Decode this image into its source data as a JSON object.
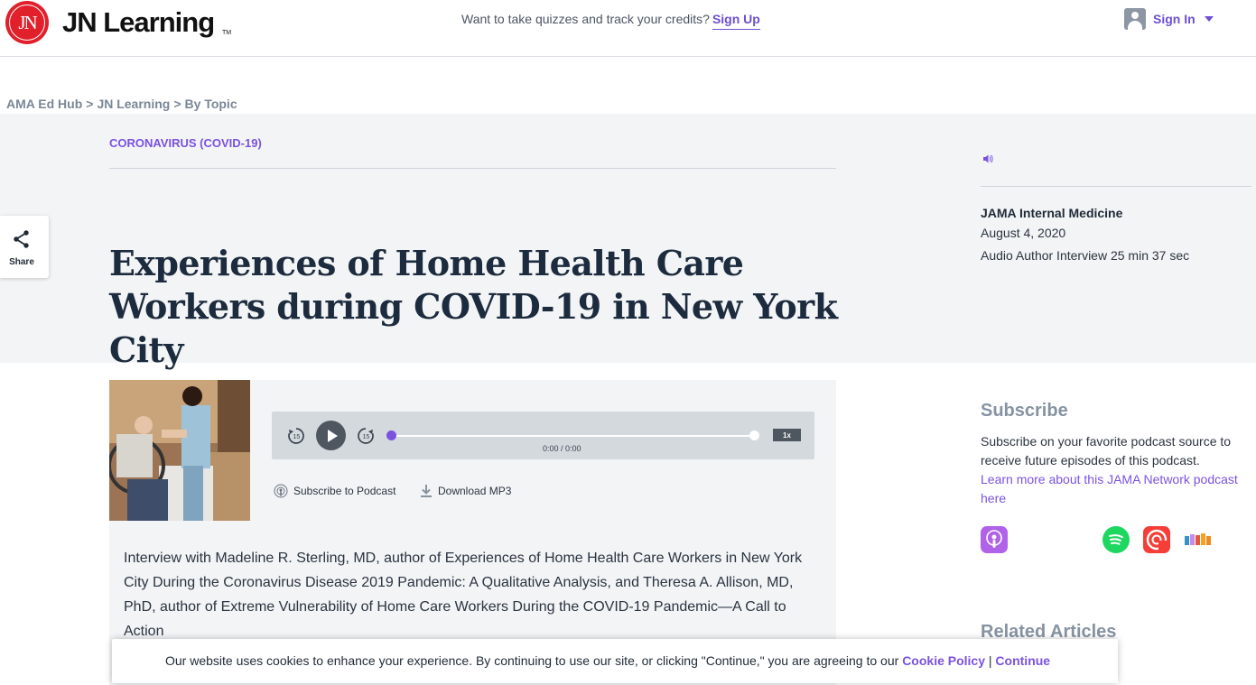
{
  "header": {
    "logo_badge": "JN",
    "logo_text": "JN Learning",
    "logo_tm": "TM",
    "cta_text": "Want to take quizzes and track your credits?",
    "cta_link": "Sign Up",
    "signin_label": "Sign In",
    "signin_icon": "user-icon"
  },
  "breadcrumb": {
    "items": [
      "AMA Ed Hub",
      "JN Learning",
      "By Topic"
    ],
    "separator": ">"
  },
  "share": {
    "label": "Share",
    "icon": "share-icon"
  },
  "article": {
    "topic": "CORONAVIRUS (COVID-19)",
    "title": "Experiences of Home Health Care Workers during COVID-19 in New York City",
    "journal": "JAMA Internal Medicine",
    "date": "August 4, 2020",
    "meta": "Audio Author Interview 25 min 37 sec",
    "audio_icon": "speaker-icon"
  },
  "player": {
    "time": "0:00 / 0:00",
    "speed": "1x",
    "progress": 0,
    "rewind_icon": "rewind-15-icon",
    "forward_icon": "forward-15-icon",
    "play_icon": "play-icon"
  },
  "links": {
    "subscribe": "Subscribe to Podcast",
    "download": "Download MP3"
  },
  "description": "Interview with Madeline R. Sterling, MD, author of Experiences of Home Health Care Workers in New York City During the Coronavirus Disease 2019 Pandemic: A Qualitative Analysis, and Theresa A. Allison, MD, PhD, author of Extreme Vulnerability of Home Care Workers During the COVID-19 Pandemic—A Call to Action",
  "sidebar": {
    "subscribe_title": "Subscribe",
    "subscribe_text": "Subscribe on your favorite podcast source to receive future episodes of this podcast.",
    "subscribe_link": "Learn more about this JAMA Network podcast here",
    "related_title": "Related Articles",
    "podcast_apps": [
      "apple-podcasts-icon",
      "spotify-icon",
      "pocket-casts-icon",
      "stitcher-icon"
    ]
  },
  "cookie": {
    "text": "Our website uses cookies to enhance your experience. By continuing to use our site, or clicking \"Continue,\" you are agreeing to our",
    "policy_link": "Cookie Policy",
    "separator": "|",
    "continue_link": "Continue"
  },
  "colors": {
    "accent": "#7b52e0",
    "brand_red": "#e0202a",
    "hero_bg": "#f2f4f6",
    "title": "#1c2b3d"
  }
}
